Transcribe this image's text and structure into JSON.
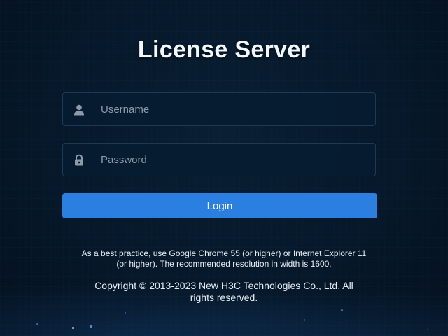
{
  "page": {
    "title": "License Server"
  },
  "form": {
    "username": {
      "icon": "user-icon",
      "placeholder": "Username",
      "value": ""
    },
    "password": {
      "icon": "lock-icon",
      "placeholder": "Password",
      "value": ""
    },
    "login_label": "Login"
  },
  "footer": {
    "browser_note": "As a best practice, use Google Chrome 55 (or higher) or Internet Explorer 11 (or higher). The recommended resolution in width is 1600.",
    "copyright": "Copyright © 2013-2023 New H3C Technologies Co., Ltd. All rights reserved."
  },
  "colors": {
    "background": "#06182a",
    "button": "#2a7fe0",
    "field_border": "#1d3a55",
    "icon": "#8d9aab"
  }
}
